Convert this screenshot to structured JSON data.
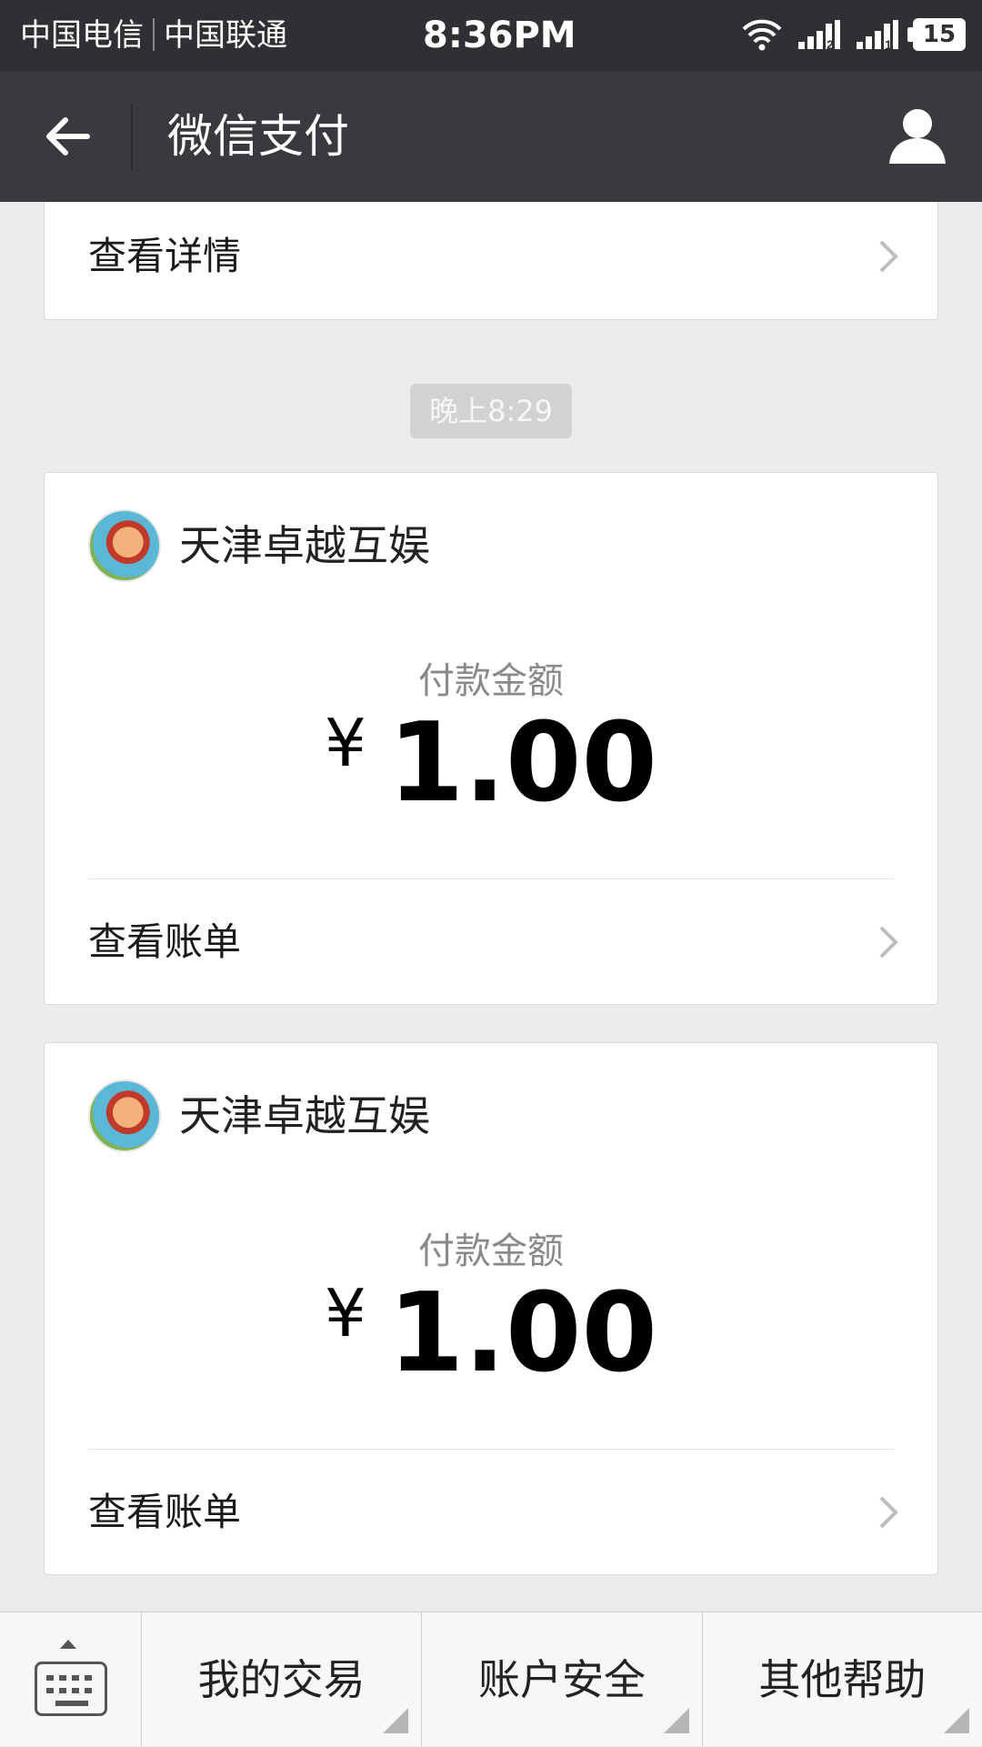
{
  "status_bar": {
    "carrier_1": "中国电信",
    "carrier_2": "中国联通",
    "time": "8:36PM",
    "battery": "15",
    "sim_1_label": "2",
    "sim_2_label": "1"
  },
  "header": {
    "title": "微信支付"
  },
  "top_card": {
    "link_label": "查看详情"
  },
  "timestamp": "晚上8:29",
  "payments": [
    {
      "merchant": "天津卓越互娱",
      "amount_label": "付款金额",
      "currency": "¥",
      "amount": "1.00",
      "link_label": "查看账单"
    },
    {
      "merchant": "天津卓越互娱",
      "amount_label": "付款金额",
      "currency": "¥",
      "amount": "1.00",
      "link_label": "查看账单"
    }
  ],
  "bottom_menu": {
    "items": [
      "我的交易",
      "账户安全",
      "其他帮助"
    ]
  },
  "colors": {
    "status_bar_bg": "#2f3034",
    "nav_bar_bg": "#393a3f",
    "page_bg": "#ebebeb",
    "card_bg": "#ffffff"
  }
}
